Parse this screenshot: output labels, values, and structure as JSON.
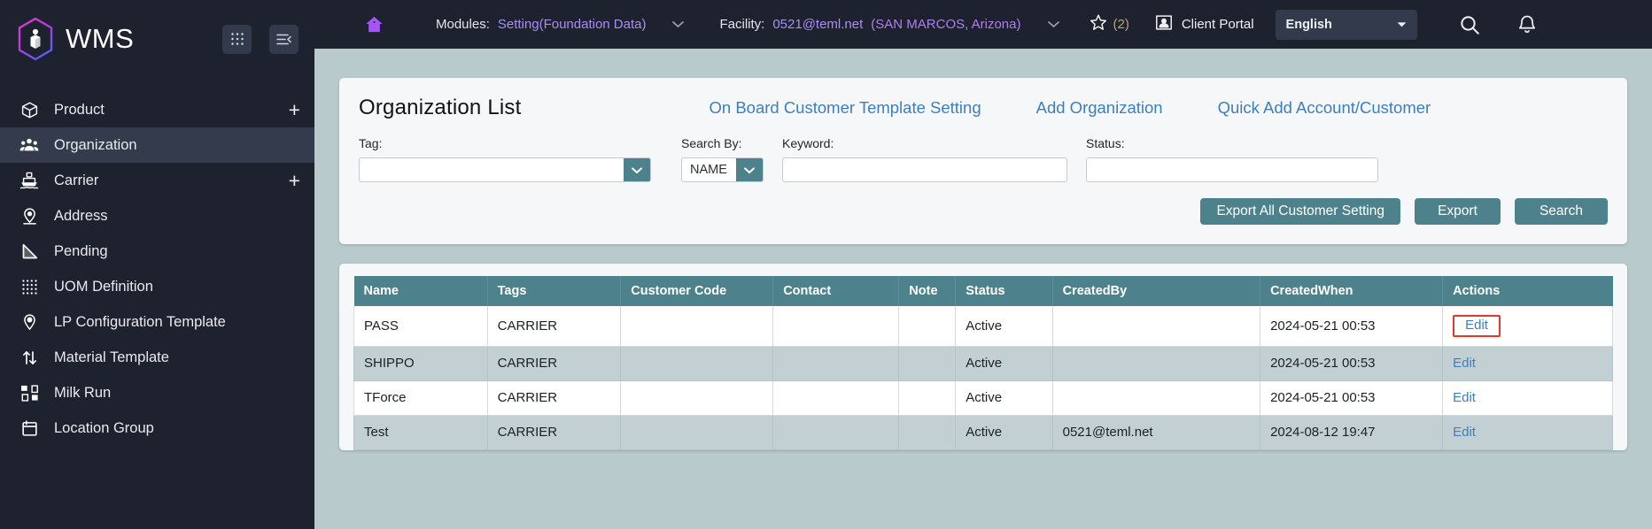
{
  "sidebar": {
    "brand": "WMS",
    "logo_icon": "hexagon-cube-logo",
    "grid_icon": "grid-apps-icon",
    "collapse_icon": "collapse-menu-icon",
    "items": [
      {
        "label": "Product",
        "icon": "box-icon",
        "plus": "+",
        "active": false
      },
      {
        "label": "Organization",
        "icon": "people-group-icon",
        "plus": "",
        "active": true
      },
      {
        "label": "Carrier",
        "icon": "ship-icon",
        "plus": "+",
        "active": false
      },
      {
        "label": "Address",
        "icon": "map-pin-icon",
        "plus": "",
        "active": false
      },
      {
        "label": "Pending",
        "icon": "ruler-icon",
        "plus": "",
        "active": false
      },
      {
        "label": "UOM Definition",
        "icon": "dot-grid-icon",
        "plus": "",
        "active": false
      },
      {
        "label": "LP Configuration Template",
        "icon": "pin-circle-icon",
        "plus": "",
        "active": false
      },
      {
        "label": "Material Template",
        "icon": "up-down-arrows-icon",
        "plus": "",
        "active": false
      },
      {
        "label": "Milk Run",
        "icon": "node-tree-icon",
        "plus": "",
        "active": false
      },
      {
        "label": "Location Group",
        "icon": "calendar-icon",
        "plus": "",
        "active": false
      }
    ]
  },
  "topbar": {
    "home_icon": "home-icon",
    "modules_label": "Modules:",
    "modules_value": "Setting(Foundation Data)",
    "modules_chevron": "chevron-down-icon",
    "facility_label": "Facility:",
    "facility_value": "0521@teml.net",
    "facility_location": "(SAN MARCOS, Arizona)",
    "facility_chevron": "chevron-down-icon",
    "star_icon": "star-icon",
    "star_count": "(2)",
    "portal_icon": "contact-card-icon",
    "portal_label": "Client Portal",
    "language_value": "English",
    "language_chevron": "caret-down-icon",
    "search_icon": "search-icon",
    "bell_icon": "notification-bell-icon"
  },
  "panel": {
    "title": "Organization List",
    "links": [
      "On Board Customer Template Setting",
      "Add Organization",
      "Quick Add Account/Customer"
    ],
    "filters": {
      "tag_label": "Tag:",
      "tag_value": "",
      "search_by_label": "Search By:",
      "search_by_value": "NAME",
      "keyword_label": "Keyword:",
      "keyword_value": "",
      "status_label": "Status:",
      "status_value": ""
    },
    "buttons": [
      "Export All Customer Setting",
      "Export",
      "Search"
    ]
  },
  "table": {
    "columns": [
      "Name",
      "Tags",
      "Customer Code",
      "Contact",
      "Note",
      "Status",
      "CreatedBy",
      "CreatedWhen",
      "Actions"
    ],
    "action_label": "Edit",
    "rows": [
      {
        "name": "PASS",
        "tags": "CARRIER",
        "customer_code": "",
        "contact": "",
        "note": "",
        "status": "Active",
        "created_by": "",
        "created_when": "2024-05-21 00:53",
        "action": "Edit",
        "highlight": true
      },
      {
        "name": "SHIPPO",
        "tags": "CARRIER",
        "customer_code": "",
        "contact": "",
        "note": "",
        "status": "Active",
        "created_by": "",
        "created_when": "2024-05-21 00:53",
        "action": "Edit",
        "highlight": false
      },
      {
        "name": "TForce",
        "tags": "CARRIER",
        "customer_code": "",
        "contact": "",
        "note": "",
        "status": "Active",
        "created_by": "",
        "created_when": "2024-05-21 00:53",
        "action": "Edit",
        "highlight": false
      },
      {
        "name": "Test",
        "tags": "CARRIER",
        "customer_code": "",
        "contact": "",
        "note": "",
        "status": "Active",
        "created_by": "0521@teml.net",
        "created_when": "2024-08-12 19:47",
        "action": "Edit",
        "highlight": false
      }
    ]
  },
  "colors": {
    "sidebar_bg": "#1d222e",
    "accent_purple": "#a98ef5",
    "teal": "#4d828c",
    "link_blue": "#3d7fbd",
    "page_bg": "#b9cacd",
    "highlight_red": "#e8352a"
  }
}
